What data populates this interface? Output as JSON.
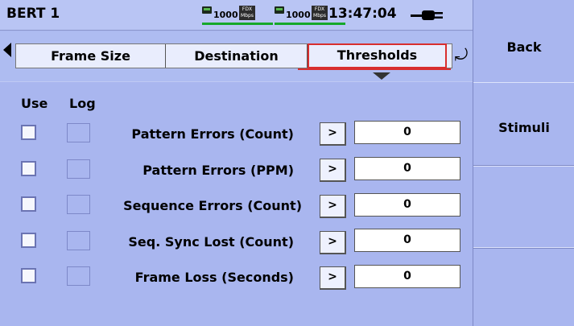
{
  "window": {
    "title": "BERT 1",
    "clock": "13:47:04"
  },
  "status": {
    "links": [
      {
        "speed": "1000",
        "duplex": "FDX",
        "unit": "Mbps",
        "color": "#16a829"
      },
      {
        "speed": "1000",
        "duplex": "FDX",
        "unit": "Mbps",
        "color": "#16a829"
      }
    ],
    "power_icon": "ac-plug-icon"
  },
  "tabs": {
    "items": [
      {
        "label": "Frame Size"
      },
      {
        "label": "Destination"
      },
      {
        "label": "Thresholds",
        "active": true
      }
    ],
    "accent": "#d82e2e"
  },
  "table": {
    "headers": {
      "use": "Use",
      "log": "Log"
    },
    "rows": [
      {
        "label": "Pattern Errors (Count)",
        "button": ">",
        "value": "0"
      },
      {
        "label": "Pattern Errors (PPM)",
        "button": ">",
        "value": "0"
      },
      {
        "label": "Sequence Errors (Count)",
        "button": ">",
        "value": "0"
      },
      {
        "label": "Seq. Sync Lost (Count)",
        "button": ">",
        "value": "0"
      },
      {
        "label": "Frame Loss (Seconds)",
        "button": ">",
        "value": "0"
      }
    ]
  },
  "sidebar": {
    "buttons": [
      {
        "label": "Back"
      },
      {
        "label": "Stimuli"
      },
      {
        "label": ""
      },
      {
        "label": ""
      }
    ]
  }
}
